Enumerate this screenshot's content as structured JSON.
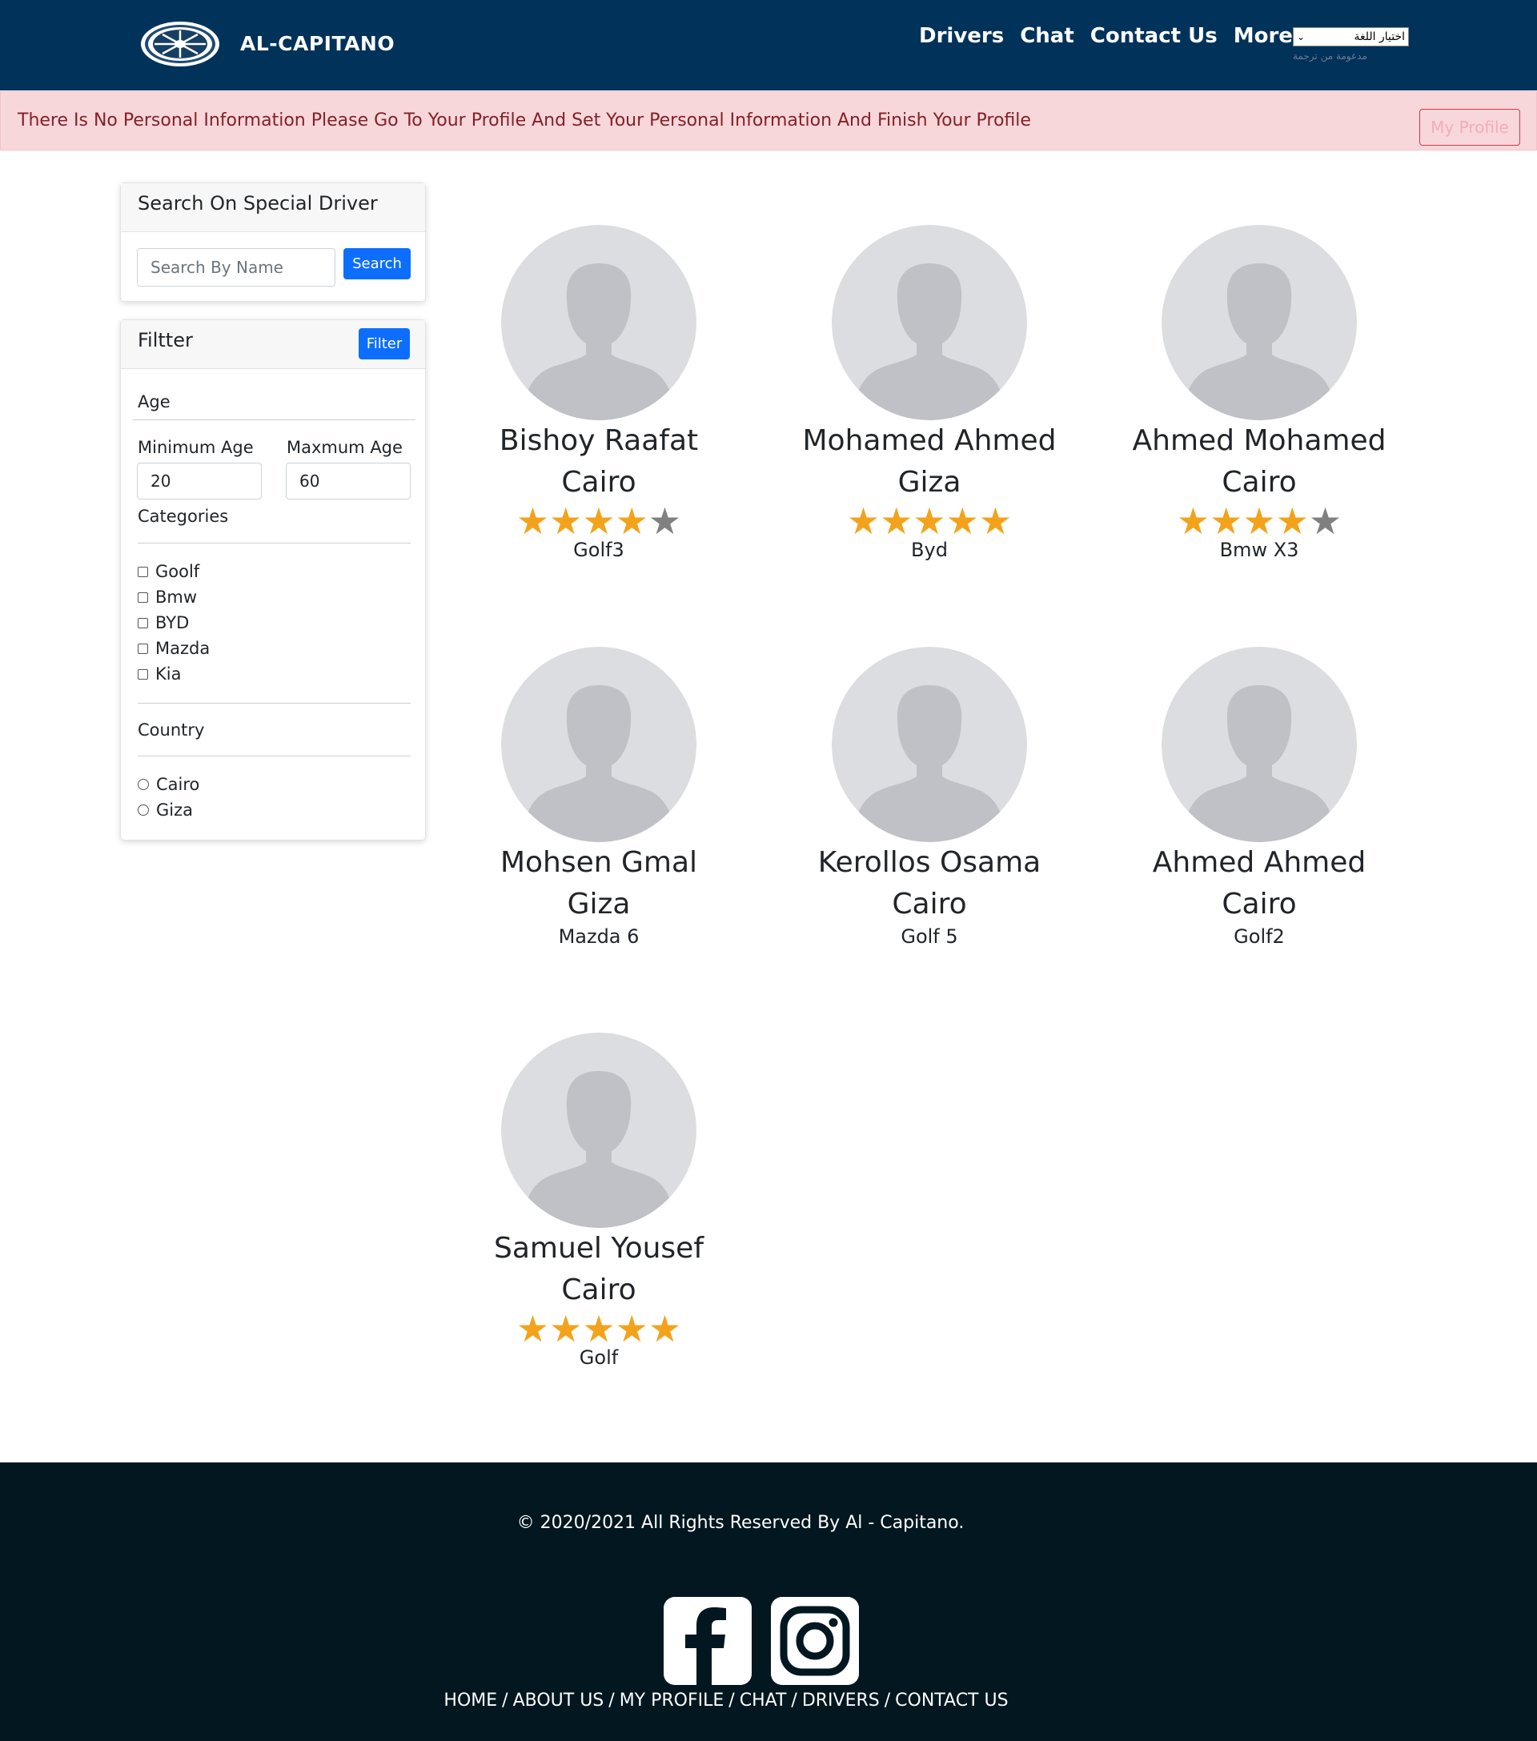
{
  "navbar": {
    "brand": "AL-CAPITANO",
    "links": [
      {
        "label": "Drivers"
      },
      {
        "label": "Chat"
      },
      {
        "label": "Contact Us"
      },
      {
        "label": "More"
      }
    ],
    "language_select": "اختيار اللغة",
    "language_sub": "مدعومة من ترجمة"
  },
  "alert": {
    "message": "There Is No Personal Information Please Go To Your Profile And Set Your Personal Information And Finish Your Profile",
    "button": "My Profile"
  },
  "search_card": {
    "title": "Search On Special Driver",
    "placeholder": "Search By Name",
    "button": "Search"
  },
  "filter_card": {
    "title": "Filtter",
    "button": "Filter",
    "age_heading": "Age",
    "min_label": "Minimum Age",
    "max_label": "Maxmum Age",
    "min_value": "20",
    "max_value": "60",
    "categories_heading": "Categories",
    "categories": [
      "Goolf",
      "Bmw",
      "BYD",
      "Mazda",
      "Kia"
    ],
    "country_heading": "Country",
    "countries": [
      "Cairo",
      "Giza"
    ]
  },
  "drivers": [
    {
      "name": "Bishoy Raafat",
      "city": "Cairo",
      "rating": 4,
      "car": "Golf3"
    },
    {
      "name": "Mohamed Ahmed",
      "city": "Giza",
      "rating": 5,
      "car": "Byd"
    },
    {
      "name": "Ahmed Mohamed",
      "city": "Cairo",
      "rating": 4,
      "car": "Bmw X3"
    },
    {
      "name": "Mohsen Gmal",
      "city": "Giza",
      "rating": null,
      "car": "Mazda 6"
    },
    {
      "name": "Kerollos Osama",
      "city": "Cairo",
      "rating": null,
      "car": "Golf 5"
    },
    {
      "name": "Ahmed Ahmed",
      "city": "Cairo",
      "rating": null,
      "car": "Golf2"
    },
    {
      "name": "Samuel Yousef",
      "city": "Cairo",
      "rating": 5,
      "car": "Golf"
    }
  ],
  "footer": {
    "copyright": "© 2020/2021 All Rights Reserved By Al - Capitano.",
    "links": [
      "HOME",
      "ABOUT US",
      "MY PROFILE",
      "CHAT",
      "DRIVERS",
      "CONTACT US"
    ]
  },
  "colors": {
    "navbar": "#01325a",
    "alert_bg": "#f8d7da",
    "primary": "#0d6efd",
    "star": "#f3a31b",
    "footer": "#02171f"
  }
}
